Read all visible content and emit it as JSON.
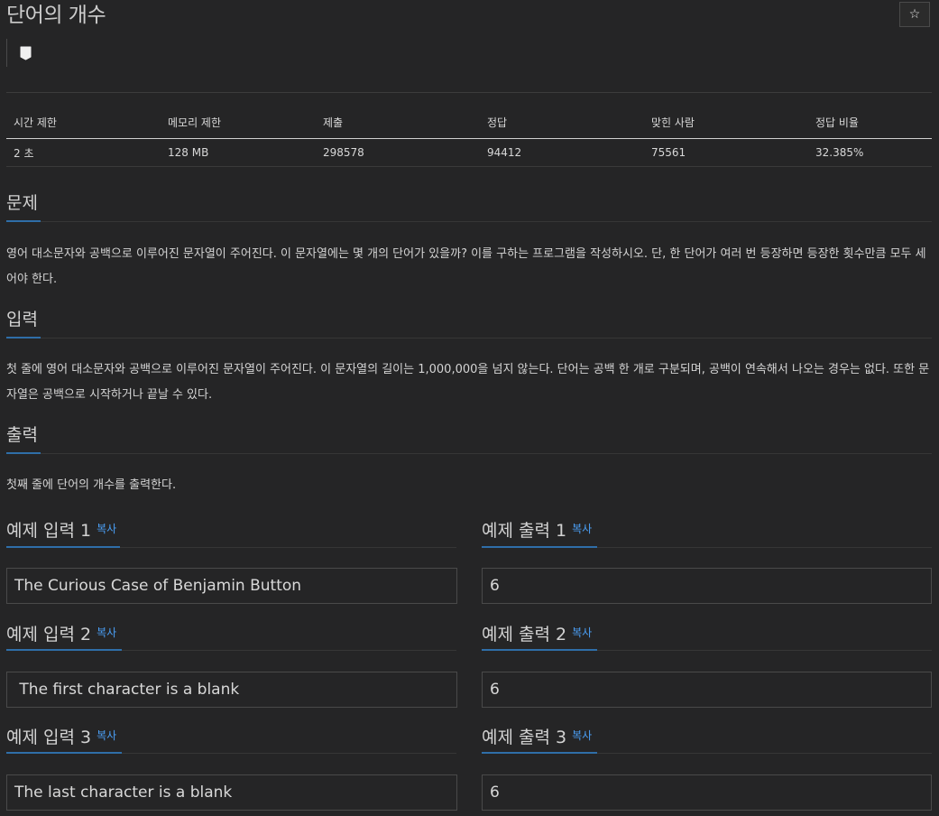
{
  "problem": {
    "title": "단어의 개수",
    "star_icon": "star-icon"
  },
  "label_icon": "bookmark-icon",
  "stats": {
    "headers": [
      "시간 제한",
      "메모리 제한",
      "제출",
      "정답",
      "맞힌 사람",
      "정답 비율"
    ],
    "values": [
      "2 초",
      "128 MB",
      "298578",
      "94412",
      "75561",
      "32.385%"
    ]
  },
  "sections": {
    "description": {
      "heading": "문제",
      "text": "영어 대소문자와 공백으로 이루어진 문자열이 주어진다. 이 문자열에는 몇 개의 단어가 있을까? 이를 구하는 프로그램을 작성하시오. 단, 한 단어가 여러 번 등장하면 등장한 횟수만큼 모두 세어야 한다."
    },
    "input": {
      "heading": "입력",
      "text": "첫 줄에 영어 대소문자와 공백으로 이루어진 문자열이 주어진다. 이 문자열의 길이는 1,000,000을 넘지 않는다. 단어는 공백 한 개로 구분되며, 공백이 연속해서 나오는 경우는 없다. 또한 문자열은 공백으로 시작하거나 끝날 수 있다."
    },
    "output": {
      "heading": "출력",
      "text": "첫째 줄에 단어의 개수를 출력한다."
    }
  },
  "copy_label": "복사",
  "samples": [
    {
      "input_heading": "예제 입력 1",
      "output_heading": "예제 출력 1",
      "input": "The Curious Case of Benjamin Button",
      "output": "6"
    },
    {
      "input_heading": "예제 입력 2",
      "output_heading": "예제 출력 2",
      "input": " The first character is a blank",
      "output": "6"
    },
    {
      "input_heading": "예제 입력 3",
      "output_heading": "예제 출력 3",
      "input": "The last character is a blank ",
      "output": "6"
    }
  ],
  "colors": {
    "background": "#252526",
    "accent": "#2f6ea8",
    "link": "#4a9ff5"
  }
}
